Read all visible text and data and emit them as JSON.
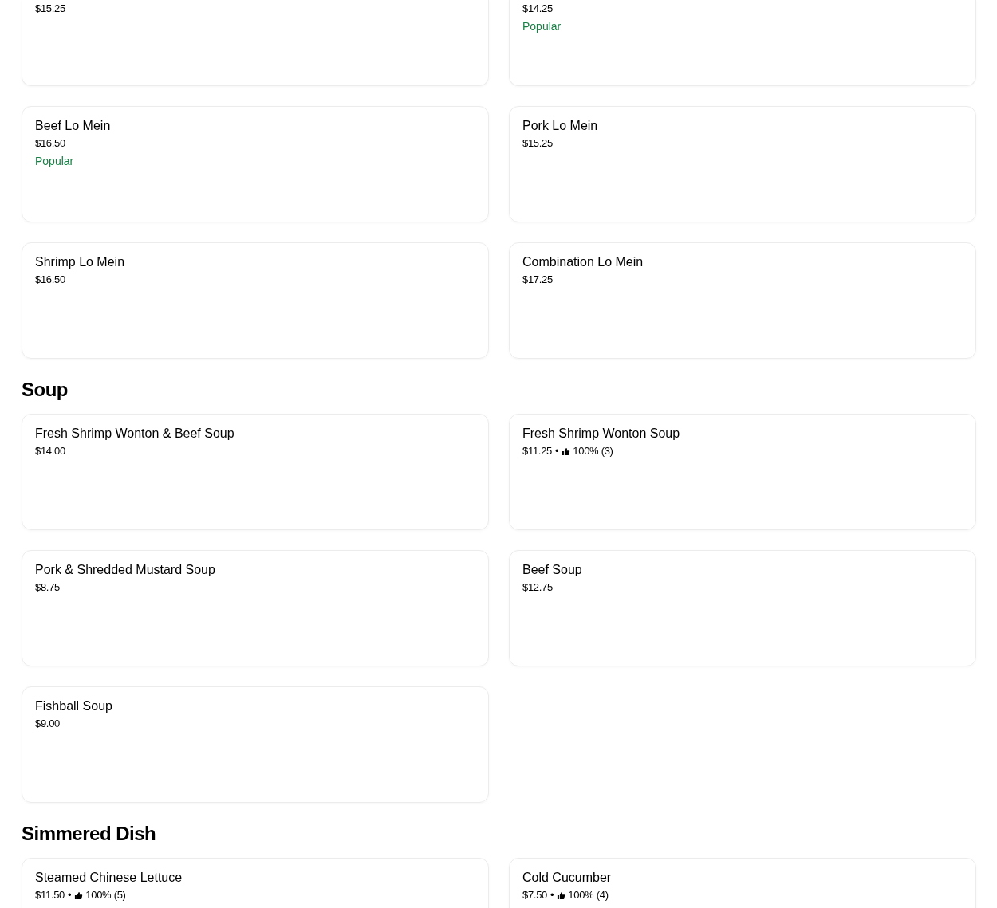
{
  "sections": [
    {
      "items": [
        {
          "price": "$15.25"
        },
        {
          "price": "$14.25",
          "badge": "Popular"
        }
      ]
    },
    {
      "items": [
        {
          "name": "Beef Lo Mein",
          "price": "$16.50",
          "badge": "Popular"
        },
        {
          "name": "Pork Lo Mein",
          "price": "$15.25"
        },
        {
          "name": "Shrimp Lo Mein",
          "price": "$16.50"
        },
        {
          "name": "Combination Lo Mein",
          "price": "$17.25"
        }
      ]
    },
    {
      "heading": "Soup",
      "items": [
        {
          "name": "Fresh Shrimp Wonton & Beef Soup",
          "price": "$14.00"
        },
        {
          "name": "Fresh Shrimp Wonton Soup",
          "price": "$11.25",
          "separator": "•",
          "rating": "100% (3)"
        },
        {
          "name": "Pork & Shredded Mustard Soup",
          "price": "$8.75"
        },
        {
          "name": "Beef Soup",
          "price": "$12.75"
        },
        {
          "name": "Fishball Soup",
          "price": "$9.00"
        }
      ]
    },
    {
      "heading": "Simmered Dish",
      "items": [
        {
          "name": "Steamed Chinese Lettuce",
          "price": "$11.50",
          "separator": "•",
          "rating": "100% (5)"
        },
        {
          "name": "Cold Cucumber",
          "price": "$7.50",
          "separator": "•",
          "rating": "100% (4)"
        }
      ]
    }
  ]
}
